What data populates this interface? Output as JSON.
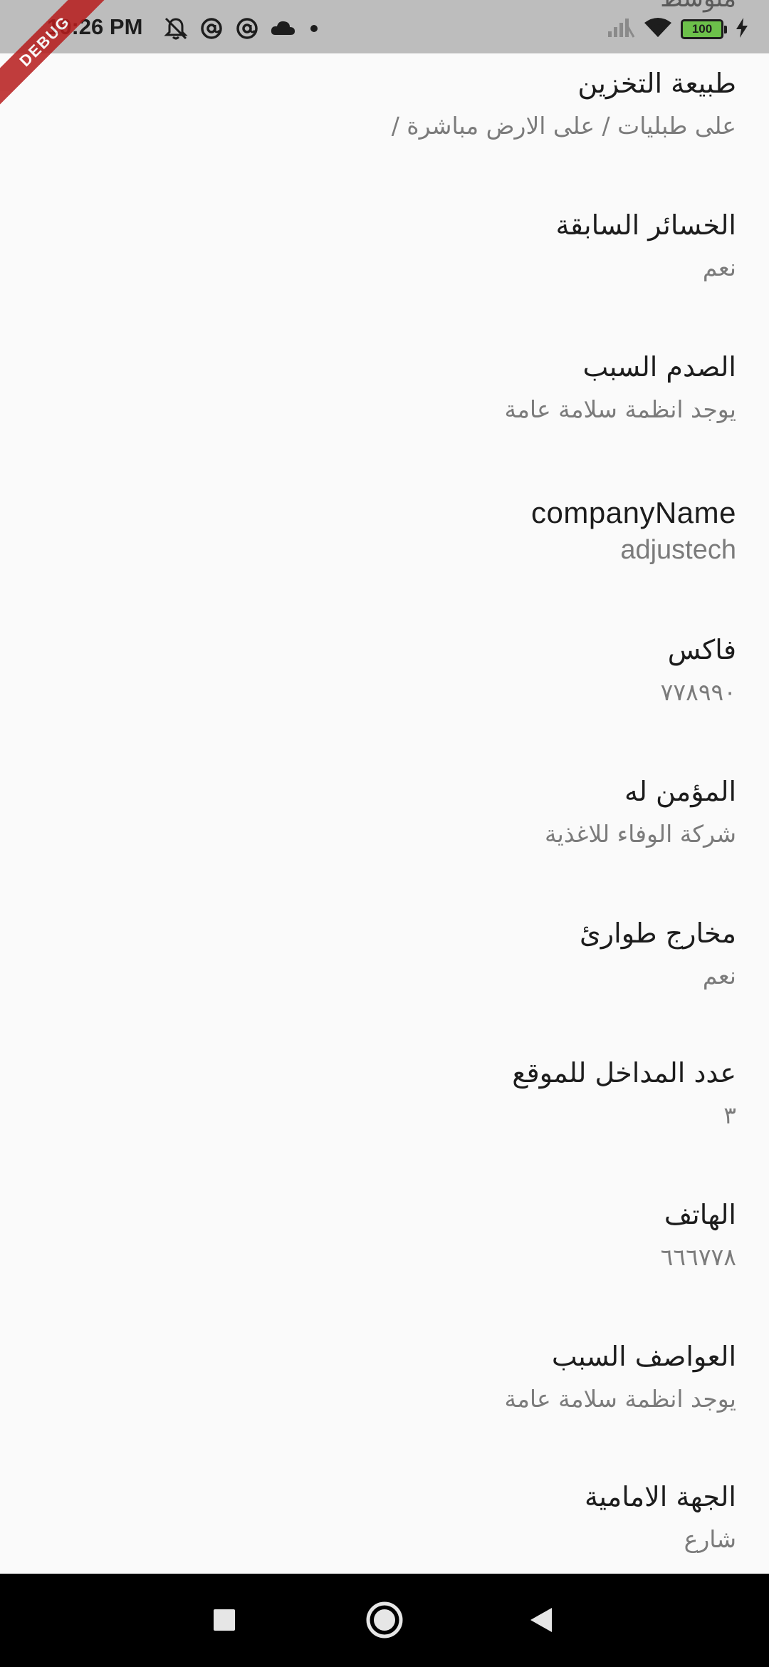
{
  "status_bar": {
    "time": "10:26 PM",
    "battery_level": "100",
    "peek_text": "متوسط",
    "left_icons": [
      "notifications-off-icon",
      "at-sign-icon",
      "at-sign-icon",
      "cloud-icon",
      "dot-icon"
    ],
    "right_icons": [
      "signal-icon",
      "wifi-icon",
      "battery-icon",
      "charging-icon"
    ]
  },
  "debug_banner": {
    "label": "DEBUG",
    "color": "#b71c1c"
  },
  "details": [
    {
      "label": "طبيعة التخزين",
      "value": "على طبليات / على الارض مباشرة /"
    },
    {
      "label": "الخسائر السابقة",
      "value": "نعم"
    },
    {
      "label": "الصدم السبب",
      "value": "يوجد انظمة سلامة عامة"
    },
    {
      "label": "companyName",
      "value": "adjustech"
    },
    {
      "label": "فاكس",
      "value": "٧٧٨٩٩٠"
    },
    {
      "label": "المؤمن له",
      "value": "شركة الوفاء للاغذية"
    },
    {
      "label": "مخارج طوارئ",
      "value": "نعم"
    },
    {
      "label": "عدد المداخل للموقع",
      "value": "٣"
    },
    {
      "label": "الهاتف",
      "value": "٦٦٦٧٧٨"
    },
    {
      "label": "العواصف السبب",
      "value": "يوجد انظمة سلامة عامة"
    },
    {
      "label": "الجهة الامامية",
      "value": "شارع"
    }
  ],
  "nav_bar": {
    "icons": [
      "recents-square-icon",
      "home-circle-icon",
      "back-triangle-icon"
    ]
  },
  "colors": {
    "status_bar_bg": "#bdbdbd",
    "page_bg": "#fafafa",
    "label_text": "#1c1c1c",
    "value_text": "#7b7b7b",
    "battery_fill": "#6cc04a",
    "nav_bar_bg": "#000000"
  }
}
